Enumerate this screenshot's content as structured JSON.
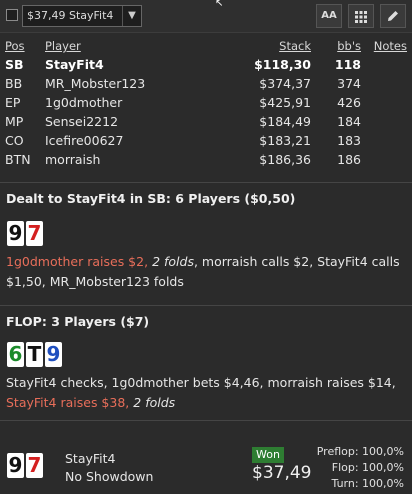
{
  "toolbar": {
    "selected_session": "$37,49 StayFit4",
    "buttons": [
      {
        "label": "AA",
        "icon": "font-size-icon"
      },
      {
        "label": "",
        "icon": "grid-icon"
      },
      {
        "label": "",
        "icon": "pencil-icon"
      }
    ]
  },
  "players_table": {
    "headers": {
      "pos": "Pos",
      "player": "Player",
      "stack": "Stack",
      "bbs": "bb's",
      "notes": "Notes"
    },
    "rows": [
      {
        "pos": "SB",
        "player": "StayFit4",
        "stack": "$118,30",
        "bbs": "118",
        "hero": true
      },
      {
        "pos": "BB",
        "player": "MR_Mobster123",
        "stack": "$374,37",
        "bbs": "374"
      },
      {
        "pos": "EP",
        "player": "1g0dmother",
        "stack": "$425,91",
        "bbs": "426"
      },
      {
        "pos": "MP",
        "player": "Sensei2212",
        "stack": "$184,49",
        "bbs": "184"
      },
      {
        "pos": "CO",
        "player": "Icefire00627",
        "stack": "$183,21",
        "bbs": "183"
      },
      {
        "pos": "BTN",
        "player": "morraish",
        "stack": "$186,36",
        "bbs": "186"
      }
    ]
  },
  "preflop": {
    "heading": "Dealt to StayFit4 in SB: 6 Players ($0,50)",
    "cards": [
      {
        "rank": "9",
        "color": "#111111"
      },
      {
        "rank": "7",
        "color": "#d42020"
      }
    ],
    "actions": {
      "a1": "1g0dmother raises $2,",
      "a2": "2 folds",
      "a3": ", morraish calls $2, StayFit4 calls $1,50, MR_Mobster123 folds"
    }
  },
  "flop": {
    "heading": "FLOP: 3 Players ($7)",
    "cards": [
      {
        "rank": "6",
        "color": "#1b8a2a"
      },
      {
        "rank": "T",
        "color": "#111111"
      },
      {
        "rank": "9",
        "color": "#1f4fbf"
      }
    ],
    "actions": {
      "a1": "StayFit4 checks, 1g0dmother bets $4,46, morraish raises $14,",
      "a2": "StayFit4 raises $38,",
      "a3": "2 folds"
    }
  },
  "summary": {
    "cards": [
      {
        "rank": "9",
        "color": "#111111"
      },
      {
        "rank": "7",
        "color": "#d42020"
      }
    ],
    "player": "StayFit4",
    "result": "No Showdown",
    "badge": "Won",
    "amount": "$37,49",
    "equity": {
      "preflop": "Preflop: 100,0%",
      "flop": "Flop: 100,0%",
      "turn": "Turn: 100,0%"
    }
  },
  "colors": {
    "highlight": "#e86e5a",
    "won_badge": "#2e7d32",
    "background": "#2b2b2b"
  }
}
